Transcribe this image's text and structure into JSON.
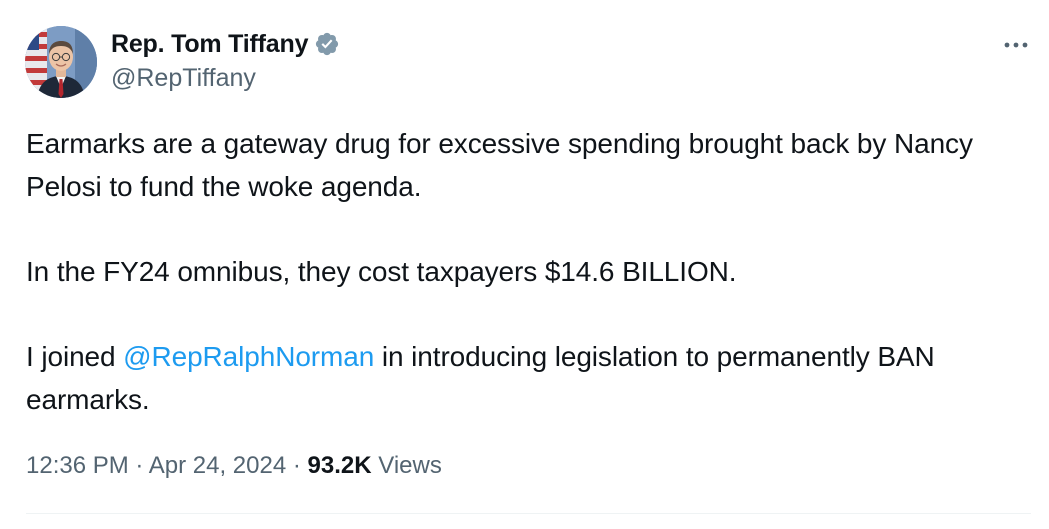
{
  "author": {
    "display_name": "Rep. Tom Tiffany",
    "handle": "@RepTiffany",
    "verified_badge_icon": "verified-badge-icon",
    "verified_color": "#829aab"
  },
  "more_icon": "more-horizontal-icon",
  "tweet": {
    "paragraph_1": "Earmarks are a gateway drug for excessive spending brought back by Nancy Pelosi to fund the woke agenda.",
    "paragraph_2": "In the FY24 omnibus, they cost taxpayers $14.6 BILLION.",
    "paragraph_3_prefix": "I joined ",
    "paragraph_3_mention": "@RepRalphNorman",
    "paragraph_3_suffix": " in introducing legislation to permanently BAN earmarks."
  },
  "meta": {
    "time": "12:36 PM",
    "separator": "·",
    "date": "Apr 24, 2024",
    "views_count": "93.2K",
    "views_label": "Views"
  },
  "colors": {
    "text_primary": "#0f1419",
    "text_secondary": "#536471",
    "link": "#1d9bf0"
  }
}
